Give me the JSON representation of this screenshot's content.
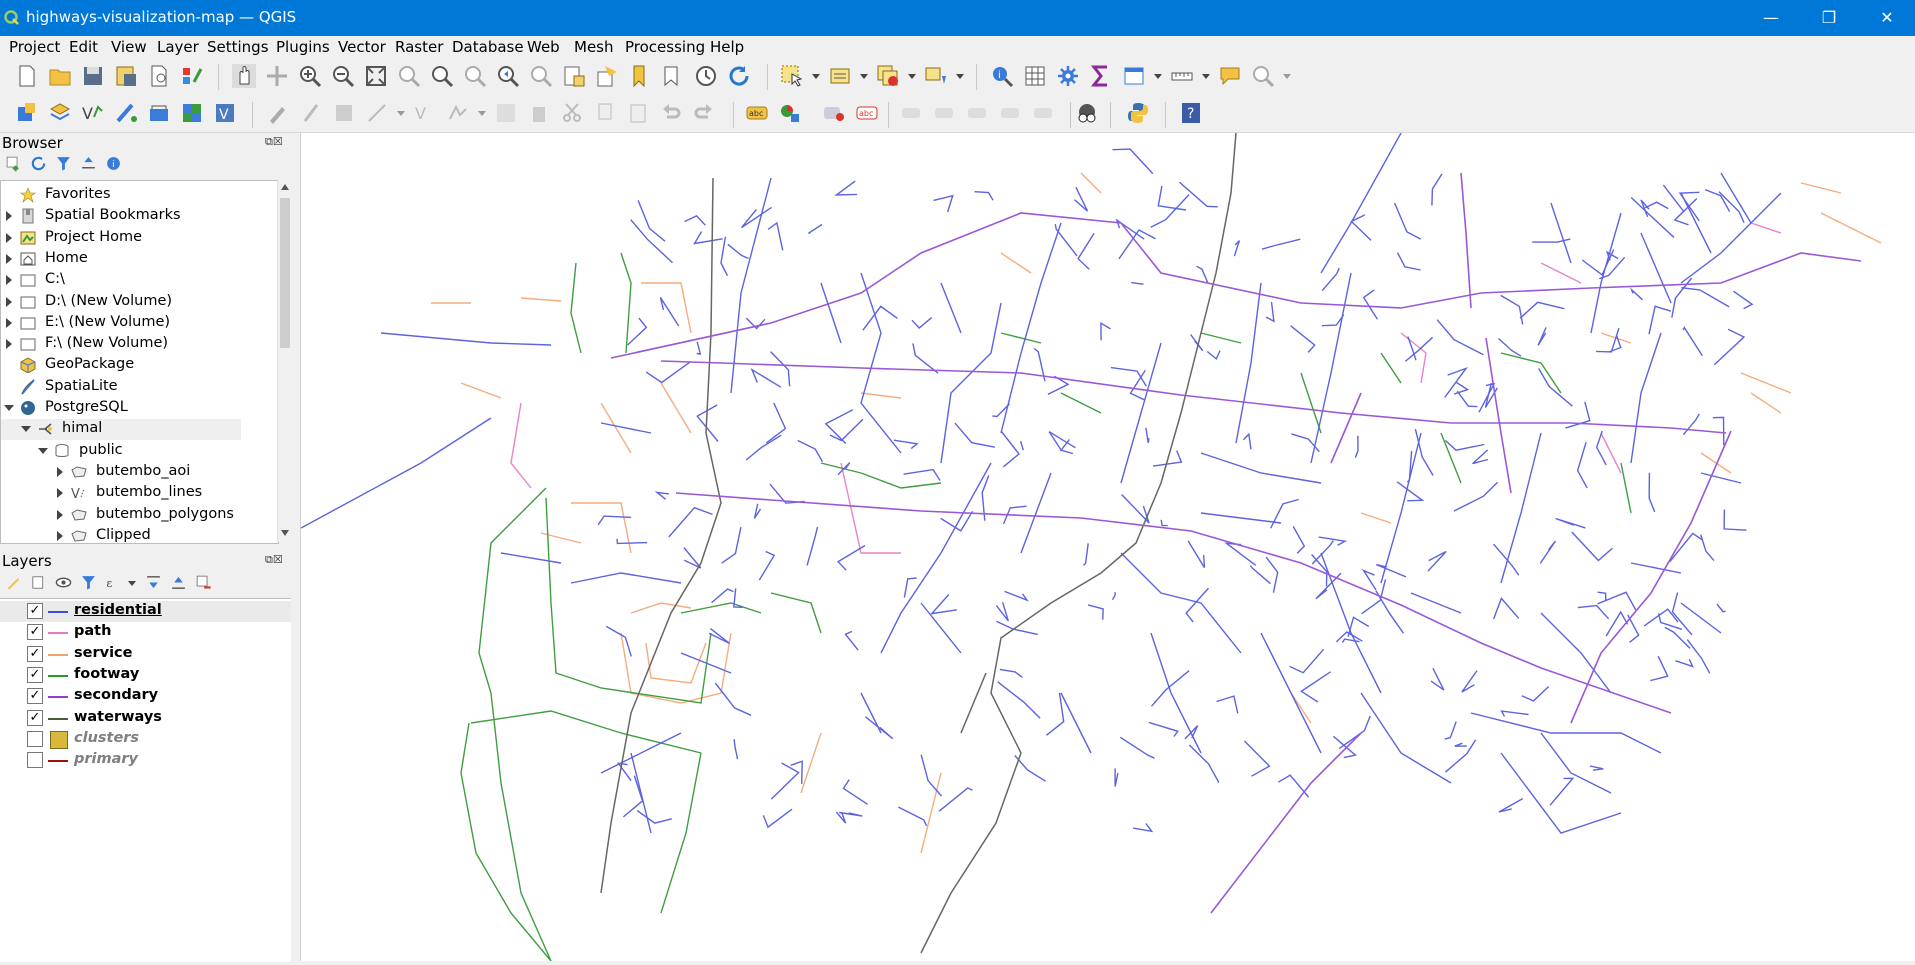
{
  "window": {
    "title": "highways-visualization-map — QGIS",
    "controls": [
      "—",
      "❐",
      "✕"
    ]
  },
  "menu": [
    "Project",
    "Edit",
    "View",
    "Layer",
    "Settings",
    "Plugins",
    "Vector",
    "Raster",
    "Database",
    "Web",
    "Mesh",
    "Processing",
    "Help"
  ],
  "browser": {
    "title": "Browser",
    "items": [
      {
        "label": "Favorites",
        "icon": "star-icon",
        "expander": "none",
        "indent": 0
      },
      {
        "label": "Spatial Bookmarks",
        "icon": "bookmark-icon",
        "expander": "right",
        "indent": 0
      },
      {
        "label": "Project Home",
        "icon": "project-home-icon",
        "expander": "right",
        "indent": 0
      },
      {
        "label": "Home",
        "icon": "home-icon",
        "expander": "right",
        "indent": 0
      },
      {
        "label": "C:\\",
        "icon": "folder-icon",
        "expander": "right",
        "indent": 0
      },
      {
        "label": "D:\\ (New Volume)",
        "icon": "folder-icon",
        "expander": "right",
        "indent": 0
      },
      {
        "label": "E:\\ (New Volume)",
        "icon": "folder-icon",
        "expander": "right",
        "indent": 0
      },
      {
        "label": "F:\\ (New Volume)",
        "icon": "folder-icon",
        "expander": "right",
        "indent": 0
      },
      {
        "label": "GeoPackage",
        "icon": "geopackage-icon",
        "expander": "none",
        "indent": 0
      },
      {
        "label": "SpatiaLite",
        "icon": "spatialite-icon",
        "expander": "none",
        "indent": 0
      },
      {
        "label": "PostgreSQL",
        "icon": "postgresql-icon",
        "expander": "down",
        "indent": 0
      },
      {
        "label": "himal",
        "icon": "connection-icon",
        "expander": "down",
        "indent": 1
      },
      {
        "label": "public",
        "icon": "schema-icon",
        "expander": "down",
        "indent": 2
      },
      {
        "label": "butembo_aoi",
        "icon": "polygon-layer-icon",
        "expander": "right",
        "indent": 3
      },
      {
        "label": "butembo_lines",
        "icon": "line-layer-icon",
        "expander": "right",
        "indent": 3
      },
      {
        "label": "butembo_polygons",
        "icon": "polygon-layer-icon",
        "expander": "right",
        "indent": 3
      },
      {
        "label": "Clipped",
        "icon": "polygon-layer-icon",
        "expander": "right",
        "indent": 3
      }
    ]
  },
  "layers": {
    "title": "Layers",
    "items": [
      {
        "name": "residential",
        "checked": true,
        "color": "#3a4fd6",
        "symbol": "line",
        "active": true
      },
      {
        "name": "path",
        "checked": true,
        "color": "#e879c2",
        "symbol": "line",
        "active": false
      },
      {
        "name": "service",
        "checked": true,
        "color": "#f0a36b",
        "symbol": "line",
        "active": false
      },
      {
        "name": "footway",
        "checked": true,
        "color": "#2e9a2e",
        "symbol": "line",
        "active": false
      },
      {
        "name": "secondary",
        "checked": true,
        "color": "#8a3fd1",
        "symbol": "line",
        "active": false
      },
      {
        "name": "waterways",
        "checked": true,
        "color": "#4a5a3a",
        "symbol": "line",
        "active": false
      },
      {
        "name": "clusters",
        "checked": false,
        "color": "#d8b83a",
        "symbol": "fill",
        "active": false
      },
      {
        "name": "primary",
        "checked": false,
        "color": "#a01010",
        "symbol": "line",
        "active": false
      }
    ]
  },
  "map_colors": {
    "residential": "#5b63e0",
    "path": "#ea82c8",
    "service": "#f3ad7d",
    "footway": "#3f9e3f",
    "secondary": "#9a58d8",
    "waterways": "#666666"
  }
}
